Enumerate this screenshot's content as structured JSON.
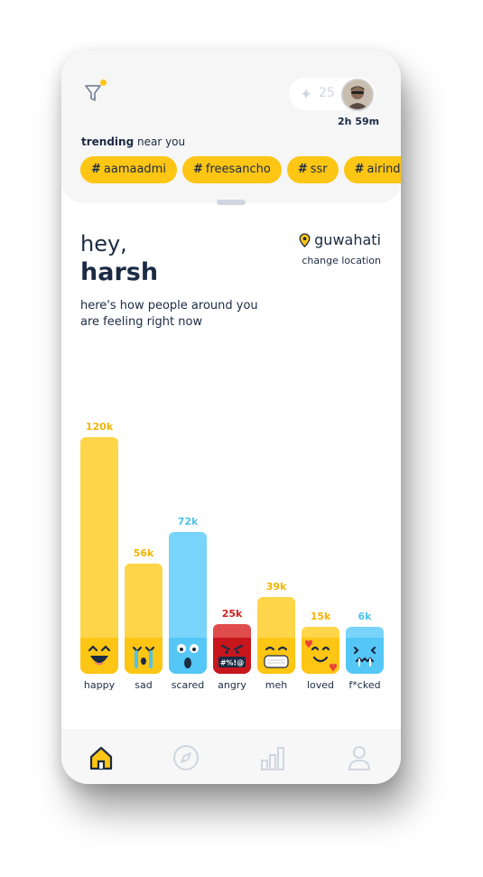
{
  "header": {
    "points": "25",
    "timer": "2h 59m",
    "trending_bold": "trending",
    "trending_rest": " near you",
    "tags": [
      {
        "hash": "#",
        "label": "aamaadmi"
      },
      {
        "hash": "#",
        "label": "freesancho"
      },
      {
        "hash": "#",
        "label": "ssr"
      },
      {
        "hash": "#",
        "label": "airindia"
      }
    ]
  },
  "greeting": {
    "hey": "hey,",
    "name": "harsh",
    "location": "guwahati",
    "change_location": "change location",
    "subtitle": "here's how people around you are feeling right now"
  },
  "colors": {
    "yellow": "#fdc514",
    "bar_yellow": "#ffd54a",
    "blue": "#78d4fb",
    "red": "#de4c4c",
    "navy": "#1b2b44"
  },
  "chart_data": {
    "type": "bar",
    "categories": [
      "happy",
      "sad",
      "scared",
      "angry",
      "meh",
      "loved",
      "f*cked"
    ],
    "values": [
      120000,
      56000,
      72000,
      25000,
      39000,
      15000,
      6000
    ],
    "value_labels": [
      "120k",
      "56k",
      "72k",
      "25k",
      "39k",
      "15k",
      "6k"
    ],
    "bar_colors": [
      "#ffd54a",
      "#ffd54a",
      "#78d4fb",
      "#de4c4c",
      "#ffd54a",
      "#ffd54a",
      "#78d4fb"
    ],
    "label_colors": [
      "#f4b400",
      "#f4b400",
      "#4cc3ee",
      "#d32020",
      "#f4b400",
      "#f4b400",
      "#4cc3ee"
    ],
    "face_icons": [
      "happy-face-icon",
      "crying-face-icon",
      "scared-face-icon",
      "angry-face-icon",
      "masked-face-icon",
      "loved-face-icon",
      "freezing-face-icon"
    ],
    "title": "",
    "xlabel": "",
    "ylabel": "",
    "grid": false,
    "legend": "none"
  },
  "nav": {
    "items": [
      "home-icon",
      "compass-icon",
      "stats-icon",
      "profile-icon"
    ],
    "active": "home-icon"
  }
}
